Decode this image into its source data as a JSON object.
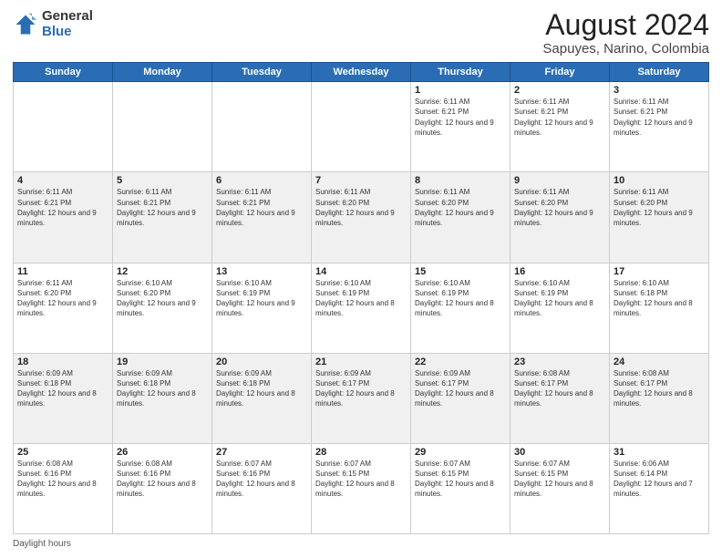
{
  "header": {
    "logo_general": "General",
    "logo_blue": "Blue",
    "title": "August 2024",
    "subtitle": "Sapuyes, Narino, Colombia"
  },
  "days_of_week": [
    "Sunday",
    "Monday",
    "Tuesday",
    "Wednesday",
    "Thursday",
    "Friday",
    "Saturday"
  ],
  "weeks": [
    [
      {
        "num": "",
        "info": ""
      },
      {
        "num": "",
        "info": ""
      },
      {
        "num": "",
        "info": ""
      },
      {
        "num": "",
        "info": ""
      },
      {
        "num": "1",
        "info": "Sunrise: 6:11 AM\nSunset: 6:21 PM\nDaylight: 12 hours and 9 minutes."
      },
      {
        "num": "2",
        "info": "Sunrise: 6:11 AM\nSunset: 6:21 PM\nDaylight: 12 hours and 9 minutes."
      },
      {
        "num": "3",
        "info": "Sunrise: 6:11 AM\nSunset: 6:21 PM\nDaylight: 12 hours and 9 minutes."
      }
    ],
    [
      {
        "num": "4",
        "info": "Sunrise: 6:11 AM\nSunset: 6:21 PM\nDaylight: 12 hours and 9 minutes."
      },
      {
        "num": "5",
        "info": "Sunrise: 6:11 AM\nSunset: 6:21 PM\nDaylight: 12 hours and 9 minutes."
      },
      {
        "num": "6",
        "info": "Sunrise: 6:11 AM\nSunset: 6:21 PM\nDaylight: 12 hours and 9 minutes."
      },
      {
        "num": "7",
        "info": "Sunrise: 6:11 AM\nSunset: 6:20 PM\nDaylight: 12 hours and 9 minutes."
      },
      {
        "num": "8",
        "info": "Sunrise: 6:11 AM\nSunset: 6:20 PM\nDaylight: 12 hours and 9 minutes."
      },
      {
        "num": "9",
        "info": "Sunrise: 6:11 AM\nSunset: 6:20 PM\nDaylight: 12 hours and 9 minutes."
      },
      {
        "num": "10",
        "info": "Sunrise: 6:11 AM\nSunset: 6:20 PM\nDaylight: 12 hours and 9 minutes."
      }
    ],
    [
      {
        "num": "11",
        "info": "Sunrise: 6:11 AM\nSunset: 6:20 PM\nDaylight: 12 hours and 9 minutes."
      },
      {
        "num": "12",
        "info": "Sunrise: 6:10 AM\nSunset: 6:20 PM\nDaylight: 12 hours and 9 minutes."
      },
      {
        "num": "13",
        "info": "Sunrise: 6:10 AM\nSunset: 6:19 PM\nDaylight: 12 hours and 9 minutes."
      },
      {
        "num": "14",
        "info": "Sunrise: 6:10 AM\nSunset: 6:19 PM\nDaylight: 12 hours and 8 minutes."
      },
      {
        "num": "15",
        "info": "Sunrise: 6:10 AM\nSunset: 6:19 PM\nDaylight: 12 hours and 8 minutes."
      },
      {
        "num": "16",
        "info": "Sunrise: 6:10 AM\nSunset: 6:19 PM\nDaylight: 12 hours and 8 minutes."
      },
      {
        "num": "17",
        "info": "Sunrise: 6:10 AM\nSunset: 6:18 PM\nDaylight: 12 hours and 8 minutes."
      }
    ],
    [
      {
        "num": "18",
        "info": "Sunrise: 6:09 AM\nSunset: 6:18 PM\nDaylight: 12 hours and 8 minutes."
      },
      {
        "num": "19",
        "info": "Sunrise: 6:09 AM\nSunset: 6:18 PM\nDaylight: 12 hours and 8 minutes."
      },
      {
        "num": "20",
        "info": "Sunrise: 6:09 AM\nSunset: 6:18 PM\nDaylight: 12 hours and 8 minutes."
      },
      {
        "num": "21",
        "info": "Sunrise: 6:09 AM\nSunset: 6:17 PM\nDaylight: 12 hours and 8 minutes."
      },
      {
        "num": "22",
        "info": "Sunrise: 6:09 AM\nSunset: 6:17 PM\nDaylight: 12 hours and 8 minutes."
      },
      {
        "num": "23",
        "info": "Sunrise: 6:08 AM\nSunset: 6:17 PM\nDaylight: 12 hours and 8 minutes."
      },
      {
        "num": "24",
        "info": "Sunrise: 6:08 AM\nSunset: 6:17 PM\nDaylight: 12 hours and 8 minutes."
      }
    ],
    [
      {
        "num": "25",
        "info": "Sunrise: 6:08 AM\nSunset: 6:16 PM\nDaylight: 12 hours and 8 minutes."
      },
      {
        "num": "26",
        "info": "Sunrise: 6:08 AM\nSunset: 6:16 PM\nDaylight: 12 hours and 8 minutes."
      },
      {
        "num": "27",
        "info": "Sunrise: 6:07 AM\nSunset: 6:16 PM\nDaylight: 12 hours and 8 minutes."
      },
      {
        "num": "28",
        "info": "Sunrise: 6:07 AM\nSunset: 6:15 PM\nDaylight: 12 hours and 8 minutes."
      },
      {
        "num": "29",
        "info": "Sunrise: 6:07 AM\nSunset: 6:15 PM\nDaylight: 12 hours and 8 minutes."
      },
      {
        "num": "30",
        "info": "Sunrise: 6:07 AM\nSunset: 6:15 PM\nDaylight: 12 hours and 8 minutes."
      },
      {
        "num": "31",
        "info": "Sunrise: 6:06 AM\nSunset: 6:14 PM\nDaylight: 12 hours and 7 minutes."
      }
    ]
  ],
  "footer": {
    "daylight_label": "Daylight hours"
  }
}
